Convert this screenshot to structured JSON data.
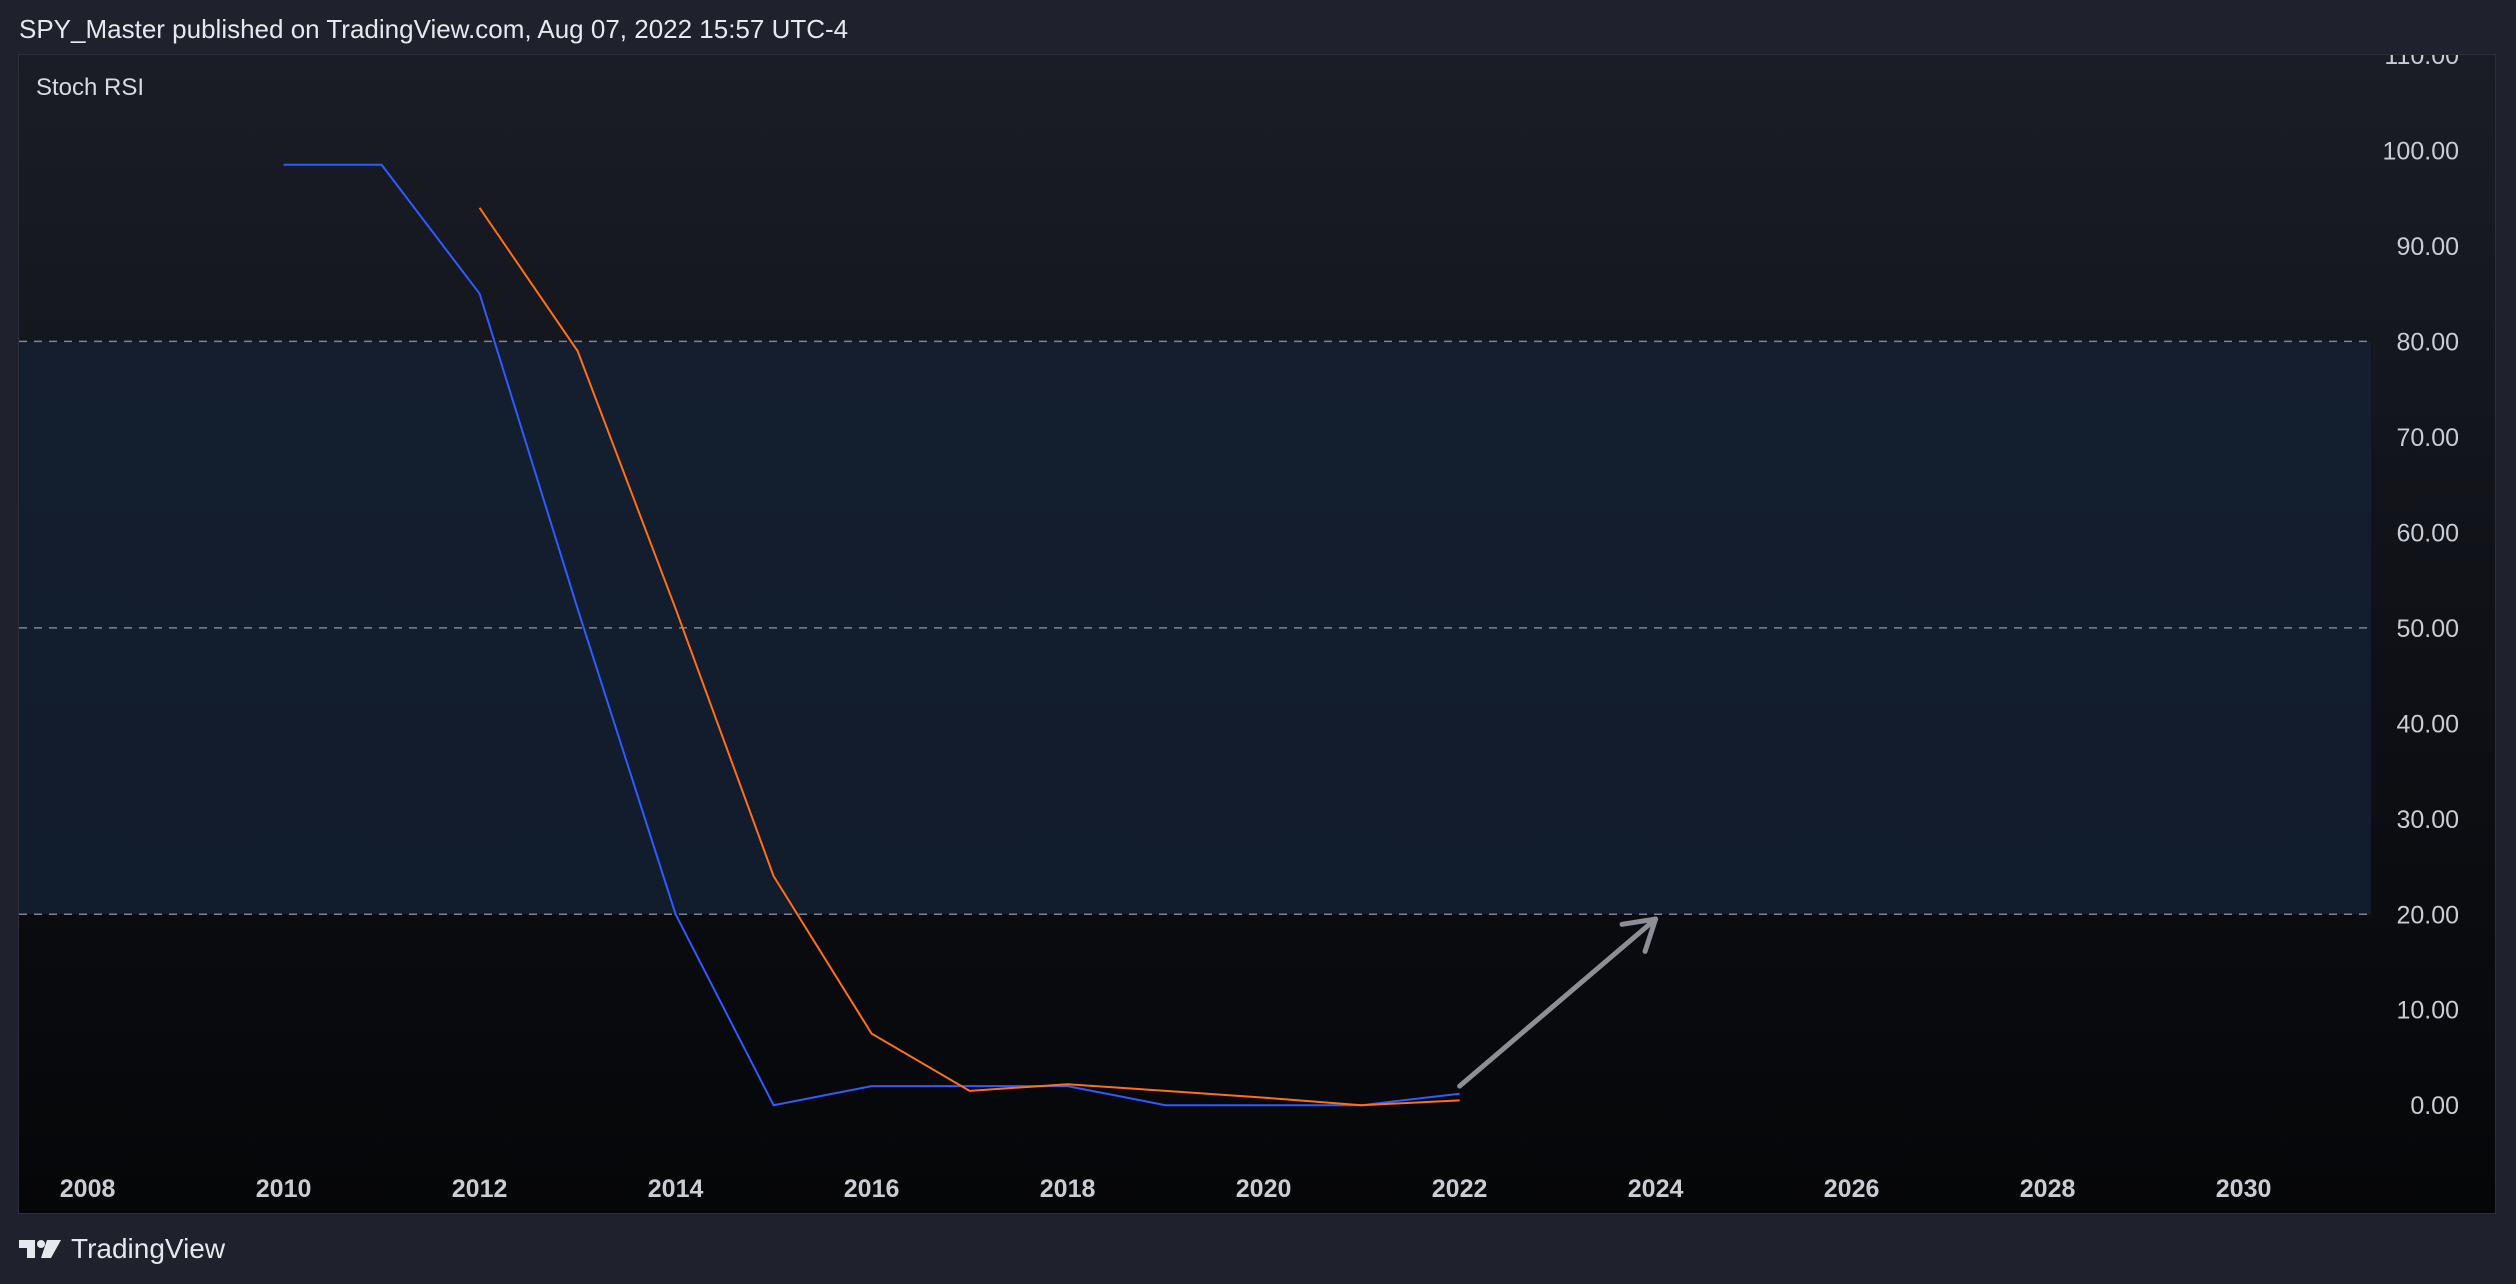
{
  "header": {
    "publish_line": "SPY_Master published on TradingView.com, Aug 07, 2022 15:57 UTC-4"
  },
  "footer": {
    "brand": "TradingView"
  },
  "chart_data": {
    "type": "line",
    "indicator_label": "Stoch RSI",
    "x_ticks": [
      "2008",
      "2010",
      "2012",
      "2014",
      "2016",
      "2018",
      "2020",
      "2022",
      "2024",
      "2026",
      "2028",
      "2030"
    ],
    "y_ticks": [
      "110.00",
      "100.00",
      "90.00",
      "80.00",
      "70.00",
      "60.00",
      "50.00",
      "40.00",
      "30.00",
      "20.00",
      "10.00",
      "0.00"
    ],
    "xlim": [
      2007.3,
      2031.3
    ],
    "ylim": [
      -11.5,
      110
    ],
    "bands": {
      "upper": 80,
      "middle": 50,
      "lower": 20
    },
    "series": [
      {
        "color": "#2f5bff",
        "points": [
          [
            2010,
            98.5
          ],
          [
            2011,
            98.5
          ],
          [
            2012,
            85
          ],
          [
            2013,
            52
          ],
          [
            2014,
            20
          ],
          [
            2015,
            0
          ],
          [
            2016,
            2
          ],
          [
            2017,
            2
          ],
          [
            2018,
            2
          ],
          [
            2019,
            0
          ],
          [
            2020,
            0
          ],
          [
            2021,
            0
          ],
          [
            2022,
            1.2
          ]
        ]
      },
      {
        "color": "#ff6f1a",
        "points": [
          [
            2012,
            94
          ],
          [
            2013,
            79
          ],
          [
            2014,
            52
          ],
          [
            2015,
            24
          ],
          [
            2016,
            7.5
          ],
          [
            2017,
            1.5
          ],
          [
            2018,
            2.2
          ],
          [
            2019,
            1.5
          ],
          [
            2020,
            0.8
          ],
          [
            2021,
            0
          ],
          [
            2022,
            0.5
          ]
        ]
      }
    ],
    "annotation": {
      "type": "arrow",
      "color": "#8c8f96",
      "from": [
        2022,
        2
      ],
      "to": [
        2024,
        19.5
      ]
    },
    "colors": {
      "band_fill": "#142136",
      "dashed_line": "#9aa0ab",
      "tick_text": "#c9ccd3"
    }
  }
}
